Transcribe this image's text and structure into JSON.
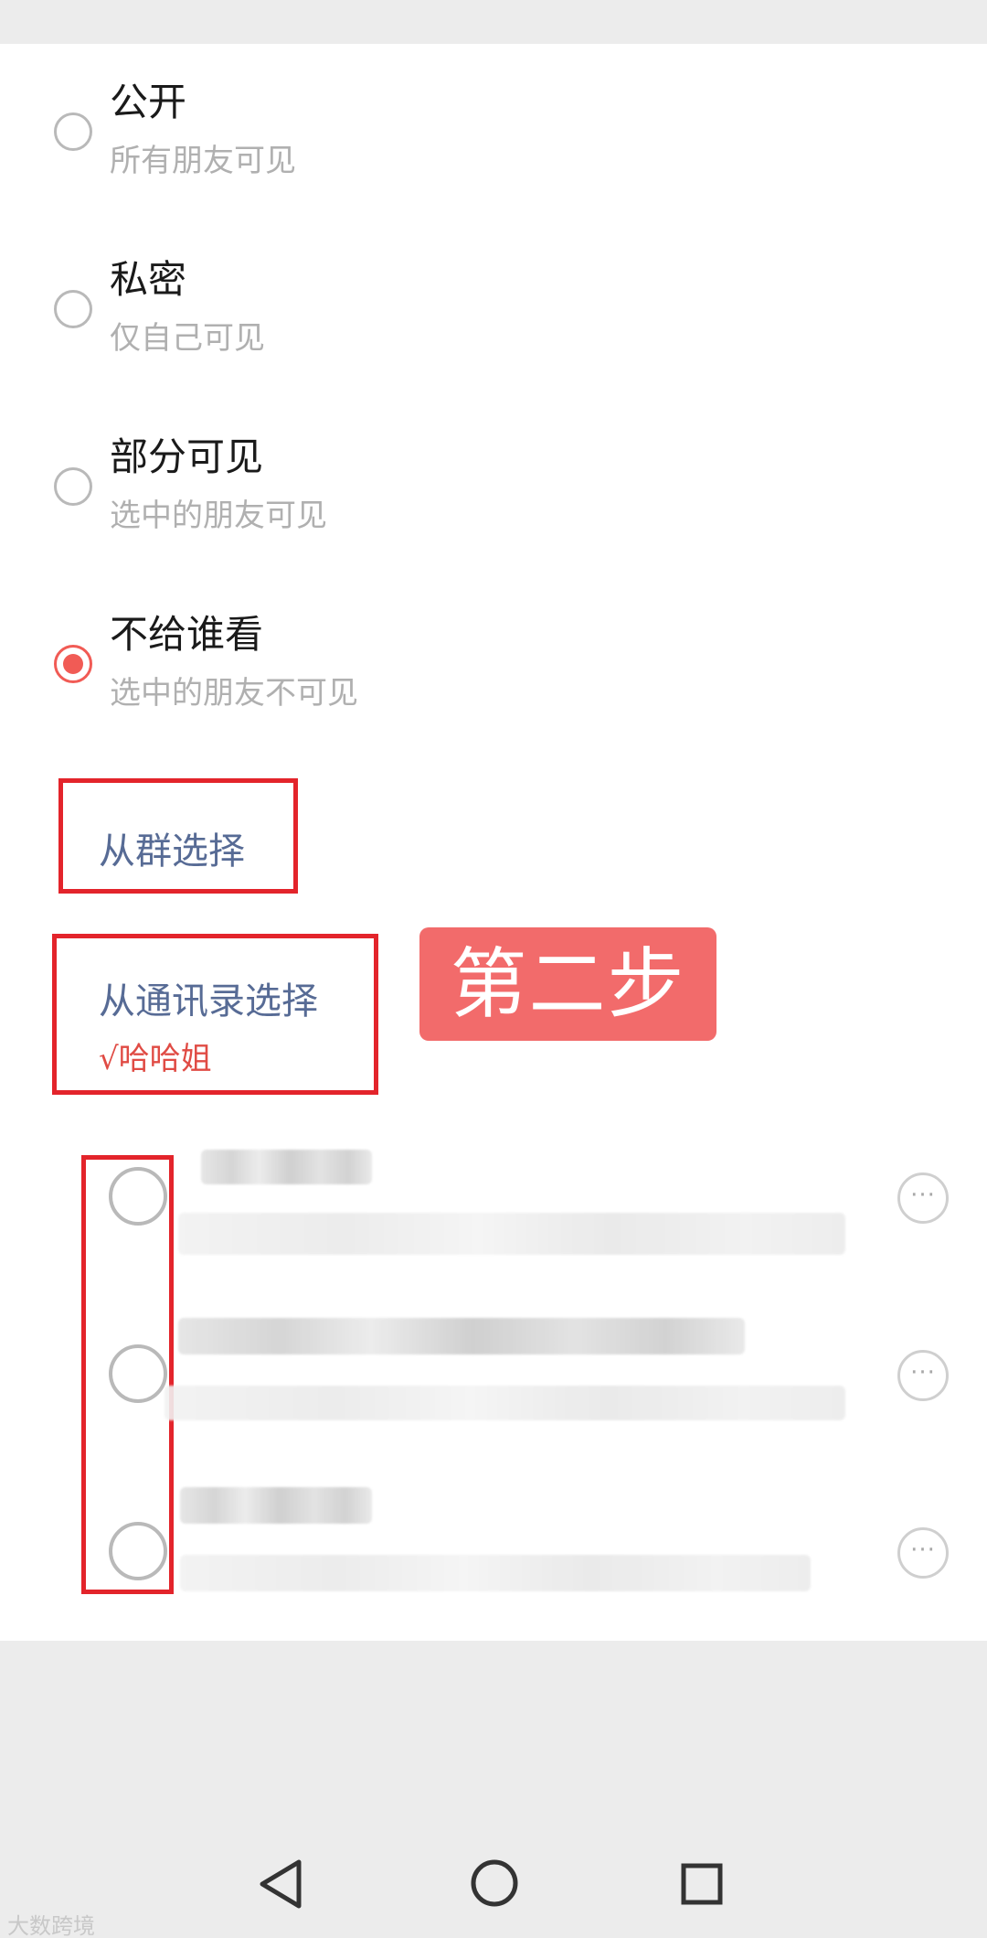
{
  "visibility_options": [
    {
      "title": "公开",
      "subtitle": "所有朋友可见",
      "selected": false
    },
    {
      "title": "私密",
      "subtitle": "仅自己可见",
      "selected": false
    },
    {
      "title": "部分可见",
      "subtitle": "选中的朋友可见",
      "selected": false
    },
    {
      "title": "不给谁看",
      "subtitle": "选中的朋友不可见",
      "selected": true
    }
  ],
  "select_from_group": "从群选择",
  "select_from_contacts": "从通讯录选择",
  "selected_contact": "√哈哈姐",
  "step_badge": "第二步",
  "contact_more_glyph": "···",
  "accent_color": "#f15b55",
  "link_color": "#576b95",
  "annotation_color": "#e3242b",
  "watermark": "大数跨境",
  "icons": [
    "back-triangle-icon",
    "home-circle-icon",
    "recents-square-icon",
    "more-icon"
  ]
}
